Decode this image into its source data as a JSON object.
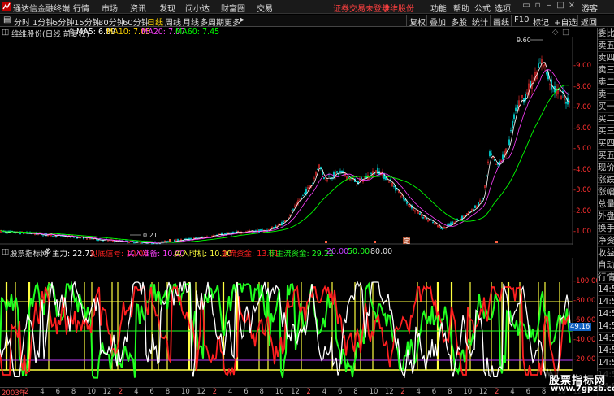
{
  "topbar": {
    "app_name": "通达信金融终端",
    "menus": [
      "行情",
      "市场",
      "资讯",
      "发现",
      "问小达",
      "财富圈",
      "交易"
    ],
    "notice": "证券交易未登录",
    "stock_tag": "维维股份",
    "right_menus": [
      "功能",
      "帮助",
      "公式",
      "选项"
    ],
    "guest": "游客"
  },
  "toolbar": {
    "periods": [
      "分时",
      "1分钟",
      "5分钟",
      "15分钟",
      "30分钟",
      "60分钟",
      "日线",
      "周线",
      "月线",
      "多周期",
      "更多"
    ],
    "active_period": "日线",
    "right_buttons": [
      "复权",
      "叠加",
      "多股",
      "统计",
      "画线",
      "F10",
      "标记",
      "+自选",
      "返回"
    ]
  },
  "kline": {
    "stock_label": "维维股份(日线 前复权)",
    "ma5": "MA5: 6.89",
    "ma10": "MA10: 7.05",
    "ma20": "MA20: 7.07",
    "ma60": "MA60: 7.45",
    "high_marker": "9.60",
    "low_marker": "0.21",
    "event_marker": "定",
    "y_ticks": [
      "9.00",
      "8.00",
      "7.00",
      "6.00",
      "5.00",
      "4.00",
      "3.00",
      "2.00",
      "1.00"
    ],
    "colors": {
      "up": "#ff3030",
      "down": "#00e0e0",
      "ma5": "#ffffff",
      "ma10": "#ffd400",
      "ma20": "#ff40ff",
      "ma60": "#00ff00"
    }
  },
  "indicator": {
    "name": "股票指标网",
    "main": "主力: 22.72",
    "sig1": "见底信号: 10.00",
    "sig2": "买入准备: 10.00",
    "sig3": "买入时机: 10.00",
    "fund1": "主流资金: 13.61",
    "fund2": "非主流资金: 29.22",
    "levels": "20.00",
    "levels2": "50.00",
    "levels3": "80.00",
    "y_ticks": [
      "100.00",
      "80.00",
      "60.00",
      "40.00",
      "20.00"
    ],
    "current_value": "49.16",
    "colors": {
      "main": "#ffffff",
      "red": "#ff2020",
      "green": "#20ff20",
      "yellow": "#ffff40",
      "purple": "#c040ff",
      "cyan": "#00c0c0"
    }
  },
  "sidebar": {
    "items": [
      "委比",
      "卖五",
      "卖四",
      "卖三",
      "卖二",
      "卖一",
      "买一",
      "买二",
      "买三",
      "买四",
      "买五",
      "现价",
      "涨跌",
      "涨幅",
      "总量",
      "外盘",
      "换手",
      "净资",
      "收益",
      "自动",
      "行情",
      "14:5",
      "14:5",
      "14:5",
      "14:5",
      "14:5",
      "14:5",
      "14:5",
      "14:5",
      "14:5"
    ]
  },
  "datebar": {
    "labels": [
      "2003年",
      "2",
      "4",
      "6",
      "8",
      "10",
      "12",
      "2",
      "4",
      "6",
      "8",
      "10",
      "12",
      "2",
      "4",
      "6",
      "8",
      "10",
      "12",
      "2",
      "4",
      "6",
      "8",
      "10",
      "12",
      "2",
      "4",
      "6",
      "8",
      "10",
      "12",
      "2",
      "4",
      "6",
      "8",
      "10",
      "12"
    ]
  },
  "watermark": {
    "title": "股票指标网",
    "url": "www.7gpzb.com"
  }
}
